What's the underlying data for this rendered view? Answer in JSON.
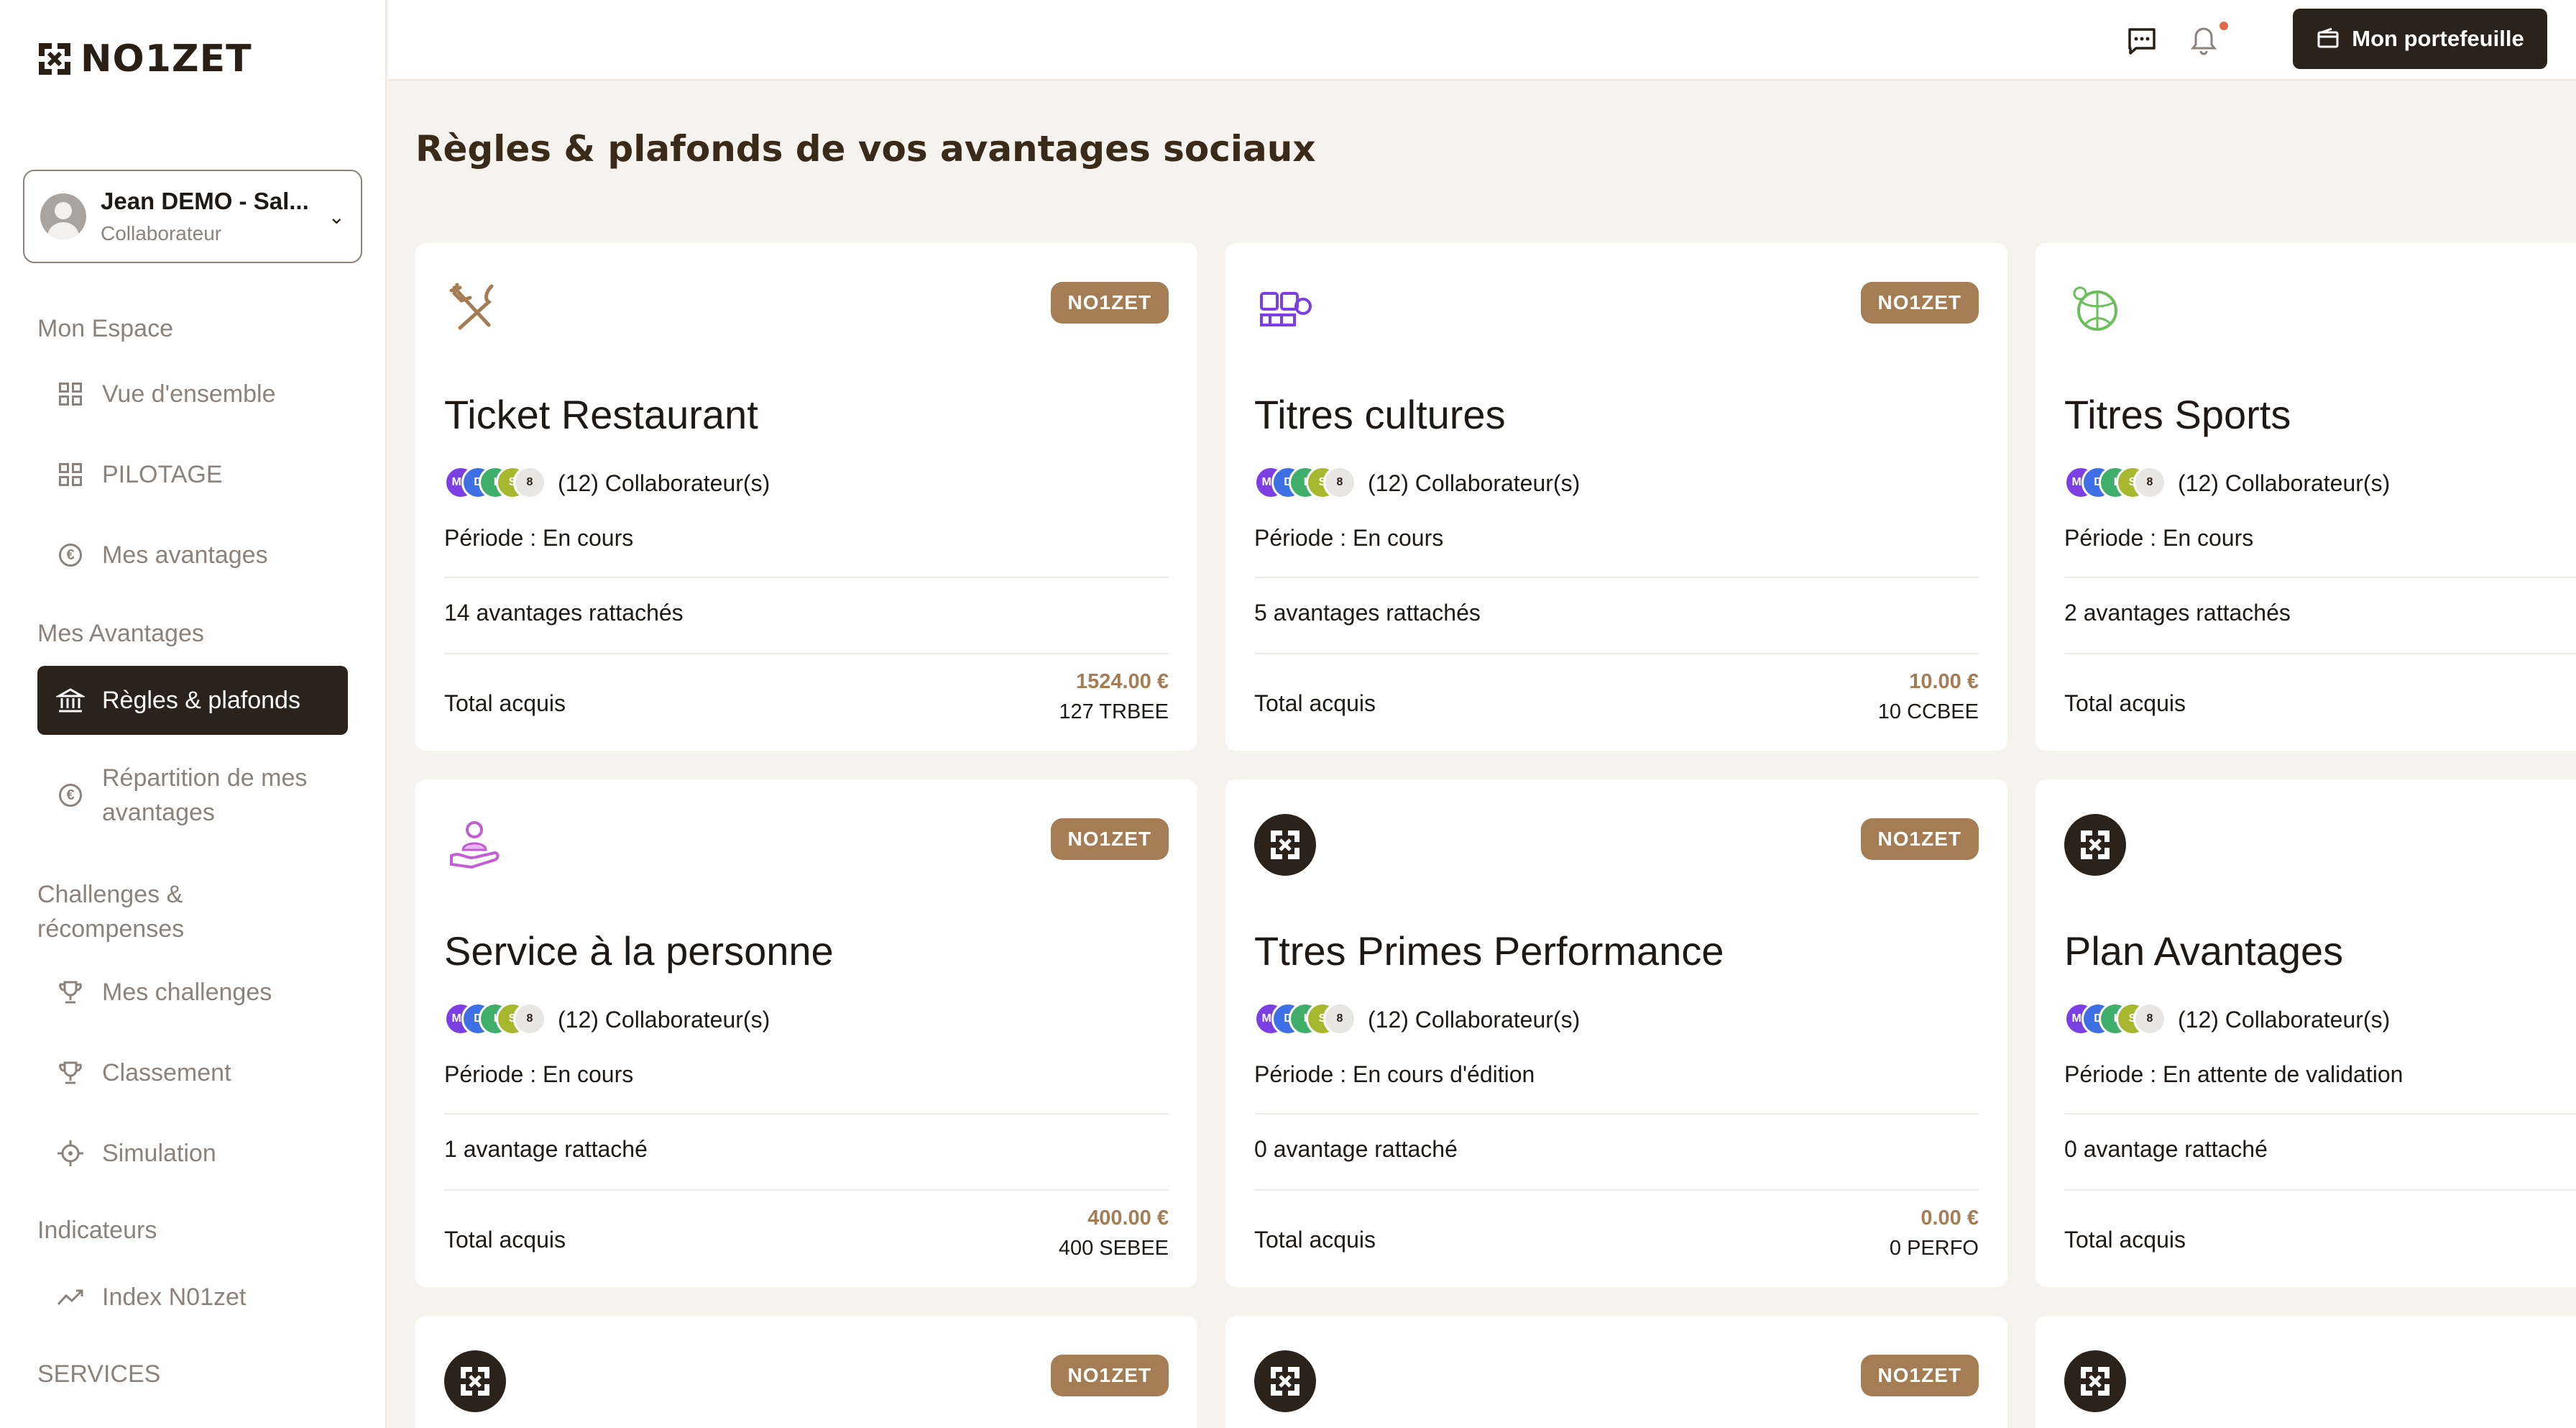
{
  "brand": {
    "name": "NO1ZET"
  },
  "user": {
    "name": "Jean DEMO - Sal...",
    "role": "Collaborateur"
  },
  "sidebar": {
    "sections": [
      {
        "label": "Mon Espace"
      },
      {
        "label": "Mes Avantages"
      },
      {
        "label": "Challenges & récompenses"
      },
      {
        "label": "Indicateurs"
      },
      {
        "label": "SERVICES"
      }
    ],
    "items": [
      {
        "label": "Vue d'ensemble",
        "icon": "grid-icon"
      },
      {
        "label": "PILOTAGE",
        "icon": "grid-icon"
      },
      {
        "label": "Mes avantages",
        "icon": "euro-icon"
      },
      {
        "label": "Règles & plafonds",
        "icon": "bank-icon",
        "active": true
      },
      {
        "label": "Répartition de mes avantages",
        "icon": "euro-icon"
      },
      {
        "label": "Mes challenges",
        "icon": "trophy-icon"
      },
      {
        "label": "Classement",
        "icon": "trophy-icon"
      },
      {
        "label": "Simulation",
        "icon": "target-icon"
      },
      {
        "label": "Index N01zet",
        "icon": "trend-icon"
      }
    ]
  },
  "topbar": {
    "wallet_label": "Mon portefeuille"
  },
  "page": {
    "title": "Règles & plafonds de vos avantages sociaux"
  },
  "cards": [
    {
      "title": "Ticket Restaurant",
      "badge": "NO1ZET",
      "collaborators": "(12) Collaborateur(s)",
      "period": "Période : En cours",
      "attached": "14  avantages rattachés",
      "total_label": "Total acquis",
      "amount": "1524.00 €",
      "units": "127 TRBEE",
      "icon": "cutlery-icon"
    },
    {
      "title": "Titres cultures",
      "badge": "NO1ZET",
      "collaborators": "(12) Collaborateur(s)",
      "period": "Période : En cours",
      "attached": "5  avantages rattachés",
      "total_label": "Total acquis",
      "amount": "10.00 €",
      "units": "10 CCBEE",
      "icon": "culture-icon"
    },
    {
      "title": "Titres Sports",
      "badge": "",
      "collaborators": "(12) Collaborateur(s)",
      "period": "Période : En cours",
      "attached": "2  avantages rattachés",
      "total_label": "Total acquis",
      "amount": "",
      "units": "",
      "icon": "sport-ball-icon"
    },
    {
      "title": "Service à la personne",
      "badge": "NO1ZET",
      "collaborators": "(12) Collaborateur(s)",
      "period": "Période : En cours",
      "attached": "1  avantage rattaché",
      "total_label": "Total acquis",
      "amount": "400.00 €",
      "units": "400 SEBEE",
      "icon": "person-service-icon"
    },
    {
      "title": "Ttres Primes Performance",
      "badge": "NO1ZET",
      "collaborators": "(12) Collaborateur(s)",
      "period": "Période : En cours d'édition",
      "attached": "0  avantage rattaché",
      "total_label": "Total acquis",
      "amount": "0.00 €",
      "units": "0 PERFO",
      "icon": "no1zet-logo-icon"
    },
    {
      "title": "Plan Avantages",
      "badge": "",
      "collaborators": "(12) Collaborateur(s)",
      "period": "Période : En attente de validation",
      "attached": "0  avantage rattaché",
      "total_label": "Total acquis",
      "amount": "",
      "units": "",
      "icon": "no1zet-logo-icon"
    },
    {
      "badge": "NO1ZET",
      "icon": "no1zet-logo-icon"
    },
    {
      "badge": "NO1ZET",
      "icon": "no1zet-logo-icon"
    },
    {
      "badge": "",
      "icon": "no1zet-logo-icon"
    }
  ],
  "avatar_stack": [
    {
      "initials": "MD",
      "color": "#7b3fe4"
    },
    {
      "initials": "D",
      "color": "#3f6fe4"
    },
    {
      "initials": "I",
      "color": "#3fae6a"
    },
    {
      "initials": "S",
      "color": "#a8b82e"
    },
    {
      "initials": "8",
      "color": "#e8e6e3"
    }
  ],
  "colors": {
    "accent": "#a47d55",
    "dark": "#2b221b"
  }
}
